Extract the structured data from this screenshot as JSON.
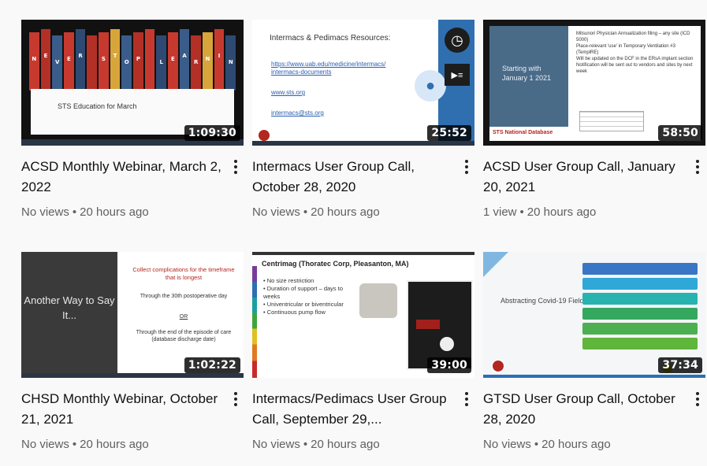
{
  "videos": [
    {
      "title": "ACSD Monthly Webinar, March 2, 2022",
      "duration": "1:09:30",
      "views": "No views",
      "age": "20 hours ago",
      "thumb_text": {
        "panel": "STS Education for March",
        "spine": "NEVER STOP LEARNING"
      },
      "book_colors": [
        "#c7392f",
        "#b33027",
        "#3a5c8a",
        "#c7392f",
        "#2e4a72",
        "#b33027",
        "#c7392f",
        "#d8a53a",
        "#3a5c8a",
        "#b33027",
        "#c7392f",
        "#2e4a72",
        "#c7392f",
        "#3a5c8a",
        "#b33027",
        "#d8a53a",
        "#c7392f",
        "#2e4a72"
      ]
    },
    {
      "title": "Intermacs User Group Call, October 28, 2020",
      "duration": "25:52",
      "views": "No views",
      "age": "20 hours ago",
      "thumb_text": {
        "header": "Intermacs & Pedimacs Resources:",
        "link1": "https://www.uab.edu/medicine/intermacs/",
        "link2": "intermacs-documents",
        "link3": "www.sts.org",
        "link4": "intermacs@sts.org"
      }
    },
    {
      "title": "ACSD User Group Call, January 20, 2021",
      "duration": "58:50",
      "views": "1 view",
      "age": "20 hours ago",
      "thumb_text": {
        "left": "Starting with January 1 2021",
        "bullets": [
          "Mitsunori Physician Annualization filing – any site (ICD 5000)",
          "Place-relevant 'use' in Temporary Ventilation #3 (TemplRE)",
          "Will be updated on the DCF in the ERsA implant section",
          "Notification will be sent out to vendors and sites by next week"
        ],
        "brand": "STS National Database"
      }
    },
    {
      "title": "CHSD Monthly Webinar, October 21, 2021",
      "duration": "1:02:22",
      "views": "No views",
      "age": "20 hours ago",
      "thumb_text": {
        "left": "Another Way to Say It...",
        "red": "Collect complications for the timeframe that is longest",
        "line1": "Through the 30th postoperative day",
        "or": "OR",
        "line2": "Through the end of the episode of care (database discharge date)"
      }
    },
    {
      "title": "Intermacs/Pedimacs User Group Call, September 29,...",
      "duration": "39:00",
      "views": "No views",
      "age": "20 hours ago",
      "thumb_text": {
        "header": "Centrimag (Thoratec Corp, Pleasanton, MA)",
        "bullets": [
          "No size restriction",
          "Duration of support – days to weeks",
          "Univentricular or biventricular",
          "Continuous pump flow"
        ]
      }
    },
    {
      "title": "GTSD User Group Call, October 28, 2020",
      "duration": "37:34",
      "views": "No views",
      "age": "20 hours ago",
      "thumb_text": {
        "left": "Abstracting Covid-19 Fields"
      },
      "bar_colors": [
        "#3a76c6",
        "#2fa8d8",
        "#27b3b0",
        "#35a85f",
        "#4caf50",
        "#5fb63b"
      ]
    }
  ],
  "separator": "•"
}
